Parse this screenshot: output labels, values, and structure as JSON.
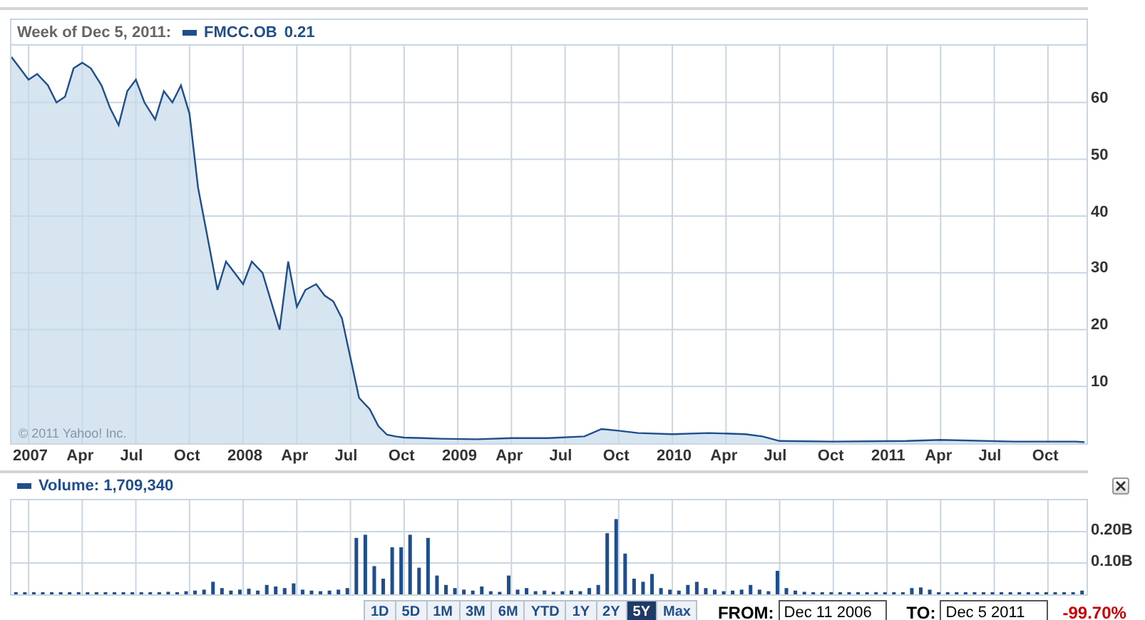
{
  "header": {
    "date_label": "Week of Dec 5, 2011:",
    "series_value": "0.21"
  },
  "price_chart": {
    "chart_data": {
      "type": "area",
      "grid": true,
      "xlim": [
        2006.92,
        2011.93
      ],
      "ylim": [
        0,
        70
      ],
      "xticks": [
        {
          "value": 2007,
          "label": "2007"
        },
        {
          "value": 2007.25,
          "label": "Apr"
        },
        {
          "value": 2007.5,
          "label": "Jul"
        },
        {
          "value": 2007.75,
          "label": "Oct"
        },
        {
          "value": 2008,
          "label": "2008"
        },
        {
          "value": 2008.25,
          "label": "Apr"
        },
        {
          "value": 2008.5,
          "label": "Jul"
        },
        {
          "value": 2008.75,
          "label": "Oct"
        },
        {
          "value": 2009,
          "label": "2009"
        },
        {
          "value": 2009.25,
          "label": "Apr"
        },
        {
          "value": 2009.5,
          "label": "Jul"
        },
        {
          "value": 2009.75,
          "label": "Oct"
        },
        {
          "value": 2010,
          "label": "2010"
        },
        {
          "value": 2010.25,
          "label": "Apr"
        },
        {
          "value": 2010.5,
          "label": "Jul"
        },
        {
          "value": 2010.75,
          "label": "Oct"
        },
        {
          "value": 2011,
          "label": "2011"
        },
        {
          "value": 2011.25,
          "label": "Apr"
        },
        {
          "value": 2011.5,
          "label": "Jul"
        },
        {
          "value": 2011.75,
          "label": "Oct"
        }
      ],
      "yticks": [
        {
          "value": 10,
          "label": "10"
        },
        {
          "value": 20,
          "label": "20"
        },
        {
          "value": 30,
          "label": "30"
        },
        {
          "value": 40,
          "label": "40"
        },
        {
          "value": 50,
          "label": "50"
        },
        {
          "value": 60,
          "label": "60"
        }
      ],
      "series": [
        {
          "name": "FMCC.OB",
          "color": "#1f4e8c",
          "x": [
            2006.92,
            2006.96,
            2007.0,
            2007.04,
            2007.09,
            2007.13,
            2007.17,
            2007.21,
            2007.25,
            2007.29,
            2007.34,
            2007.38,
            2007.42,
            2007.46,
            2007.5,
            2007.54,
            2007.59,
            2007.63,
            2007.67,
            2007.71,
            2007.75,
            2007.79,
            2007.84,
            2007.88,
            2007.92,
            2007.96,
            2008.0,
            2008.04,
            2008.09,
            2008.13,
            2008.17,
            2008.21,
            2008.25,
            2008.29,
            2008.34,
            2008.38,
            2008.42,
            2008.46,
            2008.5,
            2008.54,
            2008.59,
            2008.63,
            2008.67,
            2008.71,
            2008.75,
            2008.84,
            2008.92,
            2009.09,
            2009.25,
            2009.42,
            2009.59,
            2009.67,
            2009.75,
            2009.84,
            2010.0,
            2010.17,
            2010.34,
            2010.42,
            2010.5,
            2010.75,
            2011.09,
            2011.25,
            2011.59,
            2011.88,
            2011.92
          ],
          "values": [
            68,
            66,
            64,
            65,
            63,
            60,
            61,
            66,
            67,
            66,
            63,
            59,
            56,
            62,
            64,
            60,
            57,
            62,
            60,
            63,
            58,
            45,
            35,
            27,
            32,
            30,
            28,
            32,
            30,
            25,
            20,
            32,
            24,
            27,
            28,
            26,
            25,
            22,
            15,
            8,
            6,
            3,
            1.5,
            1.2,
            1.0,
            0.9,
            0.8,
            0.7,
            0.9,
            0.9,
            1.2,
            2.5,
            2.2,
            1.8,
            1.6,
            1.8,
            1.6,
            1.2,
            0.4,
            0.3,
            0.4,
            0.6,
            0.3,
            0.3,
            0.2
          ]
        }
      ]
    }
  },
  "copyright": "© 2011 Yahoo! Inc.",
  "volume": {
    "label": "Volume: 1,709,340",
    "chart_data": {
      "type": "bar",
      "grid": true,
      "ylim": [
        0,
        0.3
      ],
      "yticks": [
        {
          "value": 0.1,
          "label": "0.10B"
        },
        {
          "value": 0.2,
          "label": "0.20B"
        }
      ],
      "values": [
        0.002,
        0.002,
        0.002,
        0.002,
        0.002,
        0.002,
        0.002,
        0.002,
        0.002,
        0.002,
        0.003,
        0.004,
        0.003,
        0.005,
        0.004,
        0.006,
        0.005,
        0.008,
        0.006,
        0.01,
        0.012,
        0.015,
        0.04,
        0.02,
        0.012,
        0.015,
        0.018,
        0.012,
        0.03,
        0.025,
        0.02,
        0.035,
        0.015,
        0.012,
        0.01,
        0.012,
        0.015,
        0.02,
        0.18,
        0.19,
        0.09,
        0.05,
        0.15,
        0.15,
        0.19,
        0.085,
        0.18,
        0.06,
        0.03,
        0.02,
        0.015,
        0.012,
        0.025,
        0.01,
        0.008,
        0.06,
        0.015,
        0.02,
        0.01,
        0.012,
        0.008,
        0.01,
        0.012,
        0.01,
        0.02,
        0.03,
        0.195,
        0.24,
        0.13,
        0.05,
        0.04,
        0.065,
        0.02,
        0.015,
        0.012,
        0.03,
        0.04,
        0.02,
        0.015,
        0.01,
        0.012,
        0.015,
        0.03,
        0.015,
        0.01,
        0.075,
        0.02,
        0.012,
        0.008,
        0.006,
        0.005,
        0.004,
        0.005,
        0.004,
        0.006,
        0.005,
        0.004,
        0.003,
        0.004,
        0.003,
        0.02,
        0.022,
        0.015,
        0.006,
        0.004,
        0.005,
        0.003,
        0.004,
        0.003,
        0.004,
        0.003,
        0.003,
        0.004,
        0.003,
        0.004,
        0.003,
        0.003,
        0.003,
        0.003,
        0.012
      ]
    }
  },
  "ranges": [
    {
      "label": "1D",
      "selected": false
    },
    {
      "label": "5D",
      "selected": false
    },
    {
      "label": "1M",
      "selected": false
    },
    {
      "label": "3M",
      "selected": false
    },
    {
      "label": "6M",
      "selected": false
    },
    {
      "label": "YTD",
      "selected": false
    },
    {
      "label": "1Y",
      "selected": false
    },
    {
      "label": "2Y",
      "selected": false
    },
    {
      "label": "5Y",
      "selected": true
    },
    {
      "label": "Max",
      "selected": false
    }
  ],
  "from": {
    "label": "FROM:",
    "value": "Dec 11 2006"
  },
  "to": {
    "label": "TO:",
    "value": "Dec 5 2011"
  },
  "change": "-99.70%"
}
